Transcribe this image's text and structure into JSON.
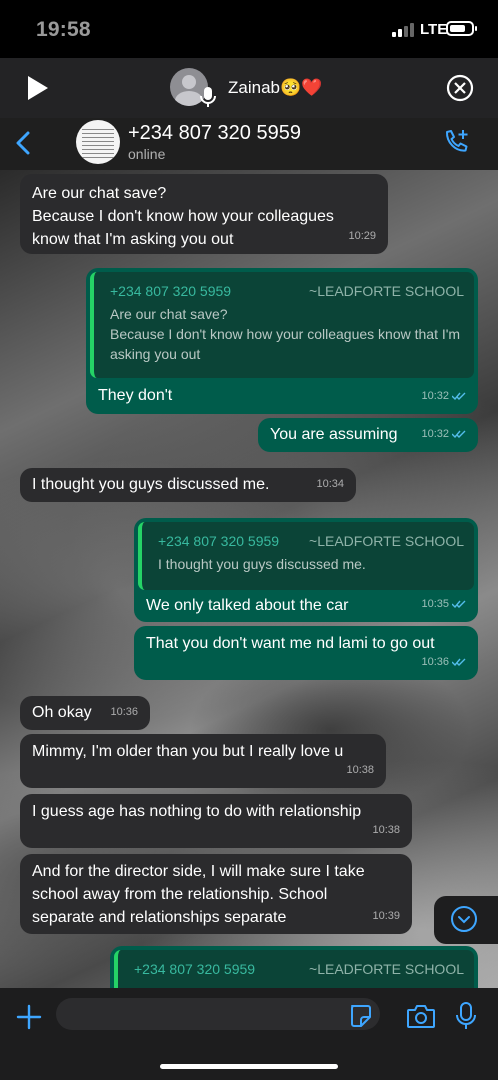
{
  "status_bar": {
    "time": "19:58",
    "network": "LTE"
  },
  "audio_bar": {
    "name": "Zainab🥺❤️"
  },
  "header": {
    "contact_name": "+234 807 320 5959",
    "contact_status": "online"
  },
  "messages": [
    {
      "direction": "incoming",
      "text": "Are our chat save?\nBecause I don't know how your colleagues know that I'm asking you out",
      "time": "10:29"
    },
    {
      "direction": "outgoing",
      "quote": {
        "name": "+234 807 320 5959",
        "source": "~LEADFORTE SCHOOL",
        "text": "Are our chat save?\nBecause I don't know how your colleagues know that I'm asking you out"
      },
      "text": "They don't",
      "time": "10:32"
    },
    {
      "direction": "outgoing",
      "text": "You are assuming",
      "time": "10:32"
    },
    {
      "direction": "incoming",
      "text": "I thought you guys discussed me.",
      "time": "10:34"
    },
    {
      "direction": "outgoing",
      "quote": {
        "name": "+234 807 320 5959",
        "source": "~LEADFORTE SCHOOL",
        "text": "I thought you guys discussed me."
      },
      "text": "We only talked about the car",
      "time": "10:35"
    },
    {
      "direction": "outgoing",
      "text": "That you don't want me nd lami to go out",
      "time": "10:36"
    },
    {
      "direction": "incoming",
      "text": "Oh okay",
      "time": "10:36"
    },
    {
      "direction": "incoming",
      "text": "Mimmy, I'm older than you but I really love u",
      "time": "10:38"
    },
    {
      "direction": "incoming",
      "text": "I guess age has nothing to do with relationship",
      "time": "10:38"
    },
    {
      "direction": "incoming",
      "text": "And for the director side, I will make sure I take school away from the relationship. School separate and relationships separate",
      "time": "10:39"
    },
    {
      "direction": "outgoing",
      "quote": {
        "name": "+234 807 320 5959",
        "source": "~LEADFORTE SCHOOL"
      }
    }
  ],
  "input": {
    "placeholder": ""
  },
  "icons": {
    "play": "play-icon",
    "close": "close-icon",
    "back": "back-icon",
    "call": "add-call-icon",
    "plus": "plus-icon",
    "sticker": "sticker-icon",
    "camera": "camera-icon",
    "mic": "microphone-icon",
    "scroll": "chevron-down-icon",
    "ticks": "read-receipt-icon"
  },
  "colors": {
    "accent": "#3ea6ff",
    "outgoing": "#005c4b",
    "incoming": "#2b2b2d",
    "quote_name": "#38b99f"
  }
}
